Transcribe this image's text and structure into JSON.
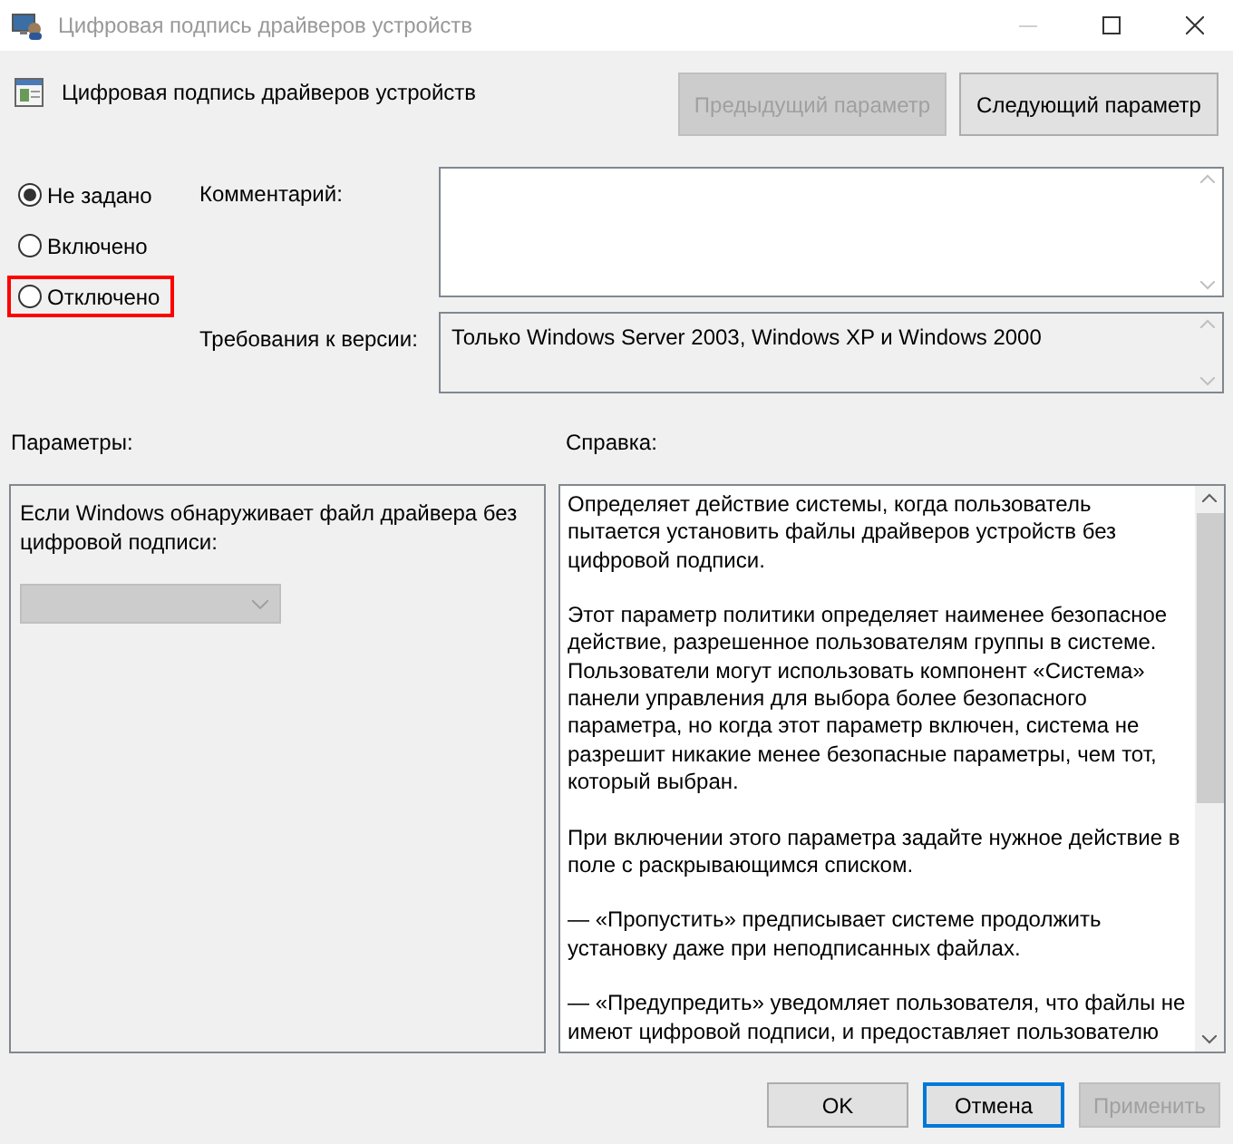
{
  "window": {
    "title": "Цифровая подпись драйверов устройств"
  },
  "header": {
    "title": "Цифровая подпись драйверов устройств",
    "buttons": [
      {
        "label": "Предыдущий параметр",
        "disabled": true
      },
      {
        "label": "Следующий параметр",
        "disabled": false
      }
    ]
  },
  "options": [
    {
      "label": "Не задано",
      "selected": true,
      "highlighted": false
    },
    {
      "label": "Включено",
      "selected": false,
      "highlighted": false
    },
    {
      "label": "Отключено",
      "selected": false,
      "highlighted": true
    }
  ],
  "comment": {
    "label": "Комментарий:"
  },
  "requirements": {
    "label": "Требования к версии:",
    "value": "Только Windows Server 2003, Windows XP и Windows 2000"
  },
  "parameters": {
    "label": "Параметры:",
    "text": "Если Windows обнаруживает файл драйвера без цифровой подписи:",
    "dropdown": {
      "disabled": true
    }
  },
  "help": {
    "label": "Справка:",
    "paragraphs": [
      "Определяет действие системы, когда пользователь пытается установить файлы драйверов устройств без цифровой подписи.",
      "Этот параметр политики определяет наименее безопасное действие, разрешенное пользователям группы в системе. Пользователи могут использовать компонент «Система» панели управления для выбора более безопасного параметра, но когда этот параметр включен, система не разрешит никакие менее безопасные параметры, чем тот, который выбран.",
      "При включении этого параметра задайте нужное действие в поле с раскрывающимся списком.",
      "— «Пропустить» предписывает системе продолжить установку даже при неподписанных файлах.",
      "— «Предупредить» уведомляет пользователя, что файлы не имеют цифровой подписи, и предоставляет пользователю"
    ]
  },
  "footer": {
    "buttons": [
      {
        "label": "OK",
        "disabled": false,
        "focused": false
      },
      {
        "label": "Отмена",
        "disabled": false,
        "focused": true
      },
      {
        "label": "Применить",
        "disabled": true,
        "focused": false
      }
    ]
  }
}
